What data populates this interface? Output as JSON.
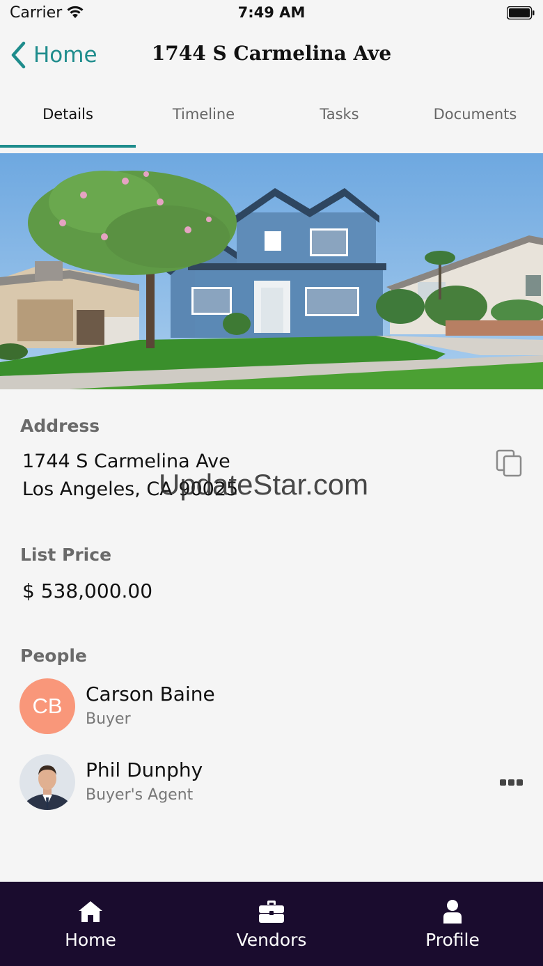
{
  "status_bar": {
    "carrier": "Carrier",
    "time": "7:49 AM"
  },
  "nav": {
    "back_label": "Home",
    "title": "1744 S Carmelina Ave"
  },
  "tabs": [
    {
      "label": "Details",
      "active": true
    },
    {
      "label": "Timeline",
      "active": false
    },
    {
      "label": "Tasks",
      "active": false
    },
    {
      "label": "Documents",
      "active": false
    }
  ],
  "address": {
    "label": "Address",
    "line1": "1744 S Carmelina Ave",
    "line2": "Los Angeles, CA 90025"
  },
  "watermark": "UpdateStar.com",
  "list_price": {
    "label": "List Price",
    "value": "$ 538,000.00"
  },
  "people": {
    "label": "People",
    "items": [
      {
        "initials": "CB",
        "name": "Carson Baine",
        "role": "Buyer",
        "avatar_color": "#f9977a"
      },
      {
        "initials": "",
        "name": "Phil Dunphy",
        "role": "Buyer's Agent"
      }
    ]
  },
  "tab_bar": [
    {
      "label": "Home",
      "icon": "home-icon"
    },
    {
      "label": "Vendors",
      "icon": "briefcase-icon"
    },
    {
      "label": "Profile",
      "icon": "person-icon"
    }
  ],
  "colors": {
    "accent": "#1e8c8c",
    "tab_bar_bg": "#1a0c2e",
    "background": "#f5f5f5"
  }
}
